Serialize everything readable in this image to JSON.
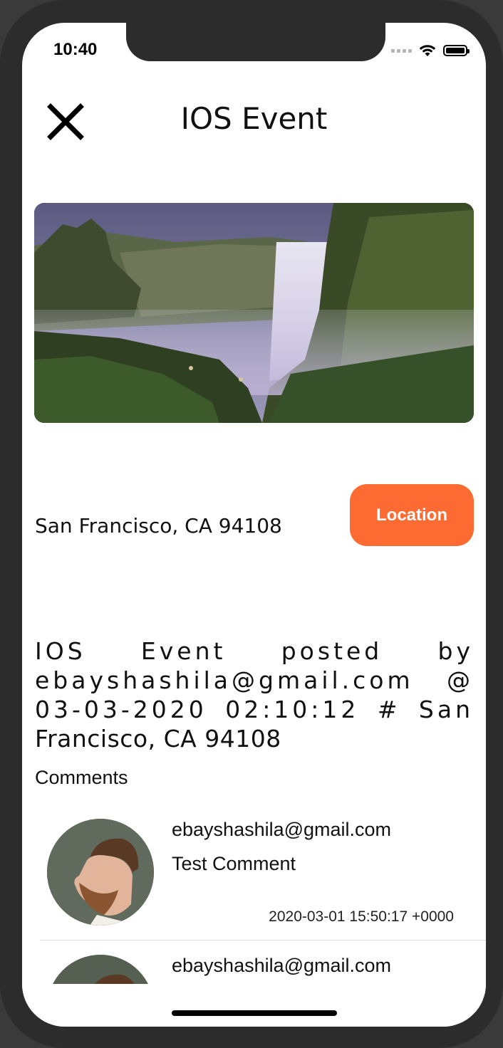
{
  "status_bar": {
    "time": "10:40"
  },
  "nav": {
    "title": "IOS Event",
    "close_icon": "close-icon"
  },
  "event": {
    "image": "waterfall-photo",
    "address": "San Francisco, CA  94108",
    "location_button": "Location",
    "description_lines": [
      "IOS Event posted by",
      "ebayshashila@gmail.com @",
      "03-03-2020 02:10:12 # San",
      "Francisco, CA  94108"
    ]
  },
  "comments": {
    "heading": "Comments",
    "items": [
      {
        "author": "ebayshashila@gmail.com",
        "text": "Test Comment",
        "timestamp": "2020-03-01 15:50:17 +0000"
      },
      {
        "author": "ebayshashila@gmail.com",
        "text": "",
        "timestamp": ""
      }
    ]
  },
  "colors": {
    "accent": "#fe6b32",
    "background": "#ffffff",
    "frame": "#2c2c2c"
  }
}
